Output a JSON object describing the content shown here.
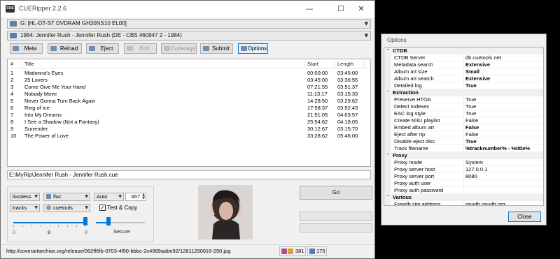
{
  "window": {
    "title": "CUERipper 2.2.6",
    "icon_text": "CUE"
  },
  "controls": {
    "minimize": "—",
    "maximize": "☐",
    "close": "✕"
  },
  "drive": {
    "label": "G: [HL-DT-ST DVDRAM GH20NS10  EL00]"
  },
  "release": {
    "label": "1984: Jennifer Rush - Jennifer Rush (DE - CBS 460947 2 - 1984)"
  },
  "toolbar": [
    {
      "label": "Meta",
      "enabled": true
    },
    {
      "label": "Reload",
      "enabled": true
    },
    {
      "label": "Eject",
      "enabled": true
    },
    {
      "label": "Edit",
      "enabled": false
    },
    {
      "label": "Coderage",
      "enabled": false
    },
    {
      "label": "Submit",
      "enabled": true
    },
    {
      "label": "Options",
      "enabled": true
    }
  ],
  "tracks": {
    "columns": {
      "num": "#",
      "title": "Title",
      "start": "Start",
      "length": "Length"
    },
    "rows": [
      {
        "num": "1",
        "title": "Madonna's Eyes",
        "start": "00:00:00",
        "length": "03:45:00"
      },
      {
        "num": "2",
        "title": "25 Lovers",
        "start": "03:45:00",
        "length": "03:36:55"
      },
      {
        "num": "3",
        "title": "Come Give Me Your Hand",
        "start": "07:21:55",
        "length": "03:51:37"
      },
      {
        "num": "4",
        "title": "Nobody Move",
        "start": "11:13:17",
        "length": "03:15:33"
      },
      {
        "num": "5",
        "title": "Never Gonna Turn Back Again",
        "start": "14:28:50",
        "length": "03:29:62"
      },
      {
        "num": "6",
        "title": "Ring of Ice",
        "start": "17:58:37",
        "length": "03:52:43"
      },
      {
        "num": "7",
        "title": "Into My Dreams",
        "start": "21:51:05",
        "length": "04:03:57"
      },
      {
        "num": "8",
        "title": "I See a Shadow (Not a Fantasy)",
        "start": "25:54:62",
        "length": "04:18:05"
      },
      {
        "num": "9",
        "title": "Surrender",
        "start": "30:12:67",
        "length": "03:15:70"
      },
      {
        "num": "10",
        "title": "The Power of Love",
        "start": "33:28:62",
        "length": "05:46:00"
      }
    ]
  },
  "output_path": "E:\\MyRip\\Jennifer Rush - Jennifer Rush.cue",
  "settings": {
    "mode": "lossless",
    "format": "flac",
    "resolution": "Auto",
    "offset": "667",
    "split": "tracks",
    "encoder": "cuetools",
    "test_copy": "Test & Copy",
    "test_copy_checked": true,
    "slider1": {
      "min": "0",
      "max": "8",
      "value": "8",
      "level": 1.0
    },
    "slider2": {
      "label": "Secure",
      "level": 0.25
    }
  },
  "go_label": "Go",
  "status": {
    "url": "http://coverartarchive.org/release/062ff6fb-0703-4f50-bbbc-2c4989aabe92/12811290016-250.jpg",
    "count1": "381",
    "count2": "175"
  },
  "options": {
    "title": "Options",
    "categories": [
      {
        "name": "CTDB",
        "items": [
          {
            "key": "CTDB Server",
            "value": "db.cuetools.net",
            "bold": false
          },
          {
            "key": "Metadata search",
            "value": "Extensive",
            "bold": true
          },
          {
            "key": "Album art size",
            "value": "Small",
            "bold": true
          },
          {
            "key": "Album art search",
            "value": "Extensive",
            "bold": true
          },
          {
            "key": "Detailed log",
            "value": "True",
            "bold": true
          }
        ]
      },
      {
        "name": "Extraction",
        "items": [
          {
            "key": "Preserve HTOA",
            "value": "True",
            "bold": false
          },
          {
            "key": "Detect Indexes",
            "value": "True",
            "bold": false
          },
          {
            "key": "EAC log style",
            "value": "True",
            "bold": false
          },
          {
            "key": "Create M3U playlist",
            "value": "False",
            "bold": false
          },
          {
            "key": "Embed album art",
            "value": "False",
            "bold": true
          },
          {
            "key": "Eject after rip",
            "value": "False",
            "bold": false
          },
          {
            "key": "Disable eject disc",
            "value": "True",
            "bold": true
          },
          {
            "key": "Track filename",
            "value": "%tracknumber% - %title%",
            "bold": true
          }
        ]
      },
      {
        "name": "Proxy",
        "items": [
          {
            "key": "Proxy mode",
            "value": "System",
            "bold": false
          },
          {
            "key": "Proxy server host",
            "value": "127.0.0.1",
            "bold": false
          },
          {
            "key": "Proxy server port",
            "value": "8080",
            "bold": false
          },
          {
            "key": "Proxy auth user",
            "value": "",
            "bold": false
          },
          {
            "key": "Proxy auth password",
            "value": "",
            "bold": false
          }
        ]
      },
      {
        "name": "Various",
        "items": [
          {
            "key": "Freedb site address",
            "value": "gnudb.gnudb.org",
            "bold": false
          }
        ]
      }
    ],
    "close_label": "Close"
  },
  "colors": {
    "accent": "#0078d7",
    "window_bg": "#f0f0f0",
    "frame": "#000000"
  }
}
